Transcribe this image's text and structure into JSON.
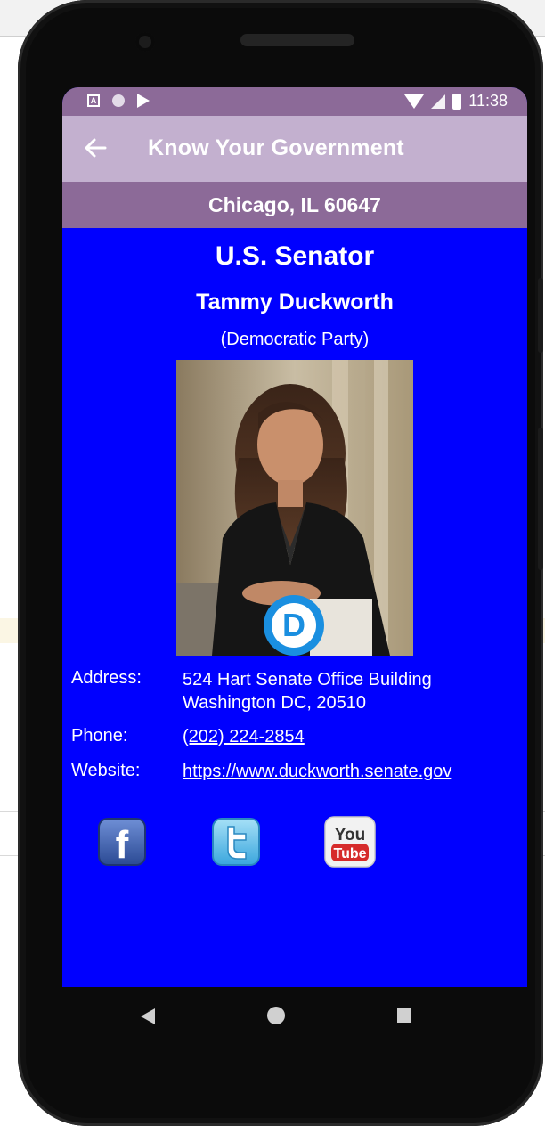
{
  "status_bar": {
    "time": "11:38"
  },
  "app_bar": {
    "title": "Know Your Government"
  },
  "location": "Chicago, IL 60647",
  "official": {
    "office": "U.S. Senator",
    "name": "Tammy Duckworth",
    "party": "(Democratic Party)",
    "party_logo_letter": "D",
    "address_label": "Address:",
    "address_line1": "524 Hart Senate Office Building",
    "address_line2": "Washington DC, 20510",
    "phone_label": "Phone:",
    "phone": "(202) 224-2854",
    "website_label": "Website:",
    "website": "https://www.duckworth.senate.gov"
  },
  "social": {
    "facebook_letter": "f",
    "youtube_top": "You",
    "youtube_bottom": "Tube"
  },
  "colors": {
    "screen_bg": "#0000ff",
    "app_bar": "#c3b0cf",
    "location_bar": "#8c6a98",
    "democrat_blue": "#1a8fe0"
  },
  "icons": [
    "back-arrow-icon",
    "facebook-icon",
    "twitter-icon",
    "youtube-icon",
    "democrat-logo-icon"
  ]
}
